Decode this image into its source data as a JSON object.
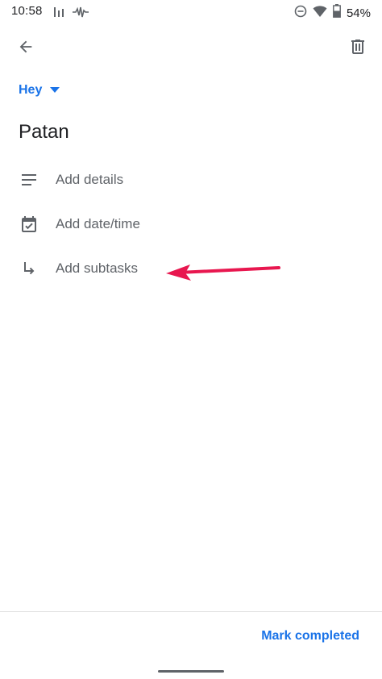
{
  "status_bar": {
    "time": "10:58",
    "battery": "54%",
    "icons": [
      "signal-bars-icon",
      "waveform-icon",
      "do-not-disturb-icon",
      "wifi-icon",
      "battery-icon"
    ]
  },
  "app_bar": {
    "back_icon": "arrow-back-icon",
    "delete_icon": "trash-icon"
  },
  "list_selector": {
    "name": "Hey",
    "icon": "dropdown-triangle-icon"
  },
  "task": {
    "title": "Patan"
  },
  "options": {
    "details": {
      "label": "Add details",
      "icon": "notes-lines-icon"
    },
    "date_time": {
      "label": "Add date/time",
      "icon": "calendar-check-icon"
    },
    "subtasks": {
      "label": "Add subtasks",
      "icon": "subtask-arrow-icon"
    }
  },
  "bottom_bar": {
    "action_label": "Mark completed"
  },
  "colors": {
    "accent": "#1a73e8",
    "text_primary": "#202124",
    "text_secondary": "#5f6368",
    "annotation": "#e8174f"
  }
}
